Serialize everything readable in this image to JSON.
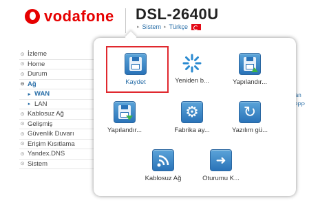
{
  "header": {
    "brand": "vodafone",
    "model": "DSL-2640U",
    "breadcrumb": [
      "Sistem",
      "Türkçe"
    ],
    "brand_color": "#e60000"
  },
  "sidebar": {
    "items": [
      {
        "label": "İzleme"
      },
      {
        "label": "Home"
      },
      {
        "label": "Durum"
      },
      {
        "label": "Ağ"
      },
      {
        "label": "WAN"
      },
      {
        "label": "LAN"
      },
      {
        "label": "Kablosuz Ağ"
      },
      {
        "label": "Gelişmiş"
      },
      {
        "label": "Güvenlik Duvarı"
      },
      {
        "label": "Erişim Kısıtlama"
      },
      {
        "label": "Yandex.DNS"
      },
      {
        "label": "Sistem"
      }
    ]
  },
  "background": {
    "partial_1": "lan",
    "partial_2": "PPP"
  },
  "popup": {
    "items": [
      {
        "label": "Kaydet",
        "icon": "save-icon"
      },
      {
        "label": "Yeniden b...",
        "icon": "reboot-icon"
      },
      {
        "label": "Yapılandır...",
        "icon": "config-upload-icon"
      },
      {
        "label": "Yapılandır...",
        "icon": "config-download-icon"
      },
      {
        "label": "Fabrika ay...",
        "icon": "factory-reset-icon"
      },
      {
        "label": "Yazılım gü...",
        "icon": "firmware-update-icon"
      },
      {
        "label": "Kablosuz Ağ",
        "icon": "wifi-icon"
      },
      {
        "label": "Oturumu K...",
        "icon": "logout-icon"
      }
    ],
    "selected_color": "#e0282e"
  }
}
